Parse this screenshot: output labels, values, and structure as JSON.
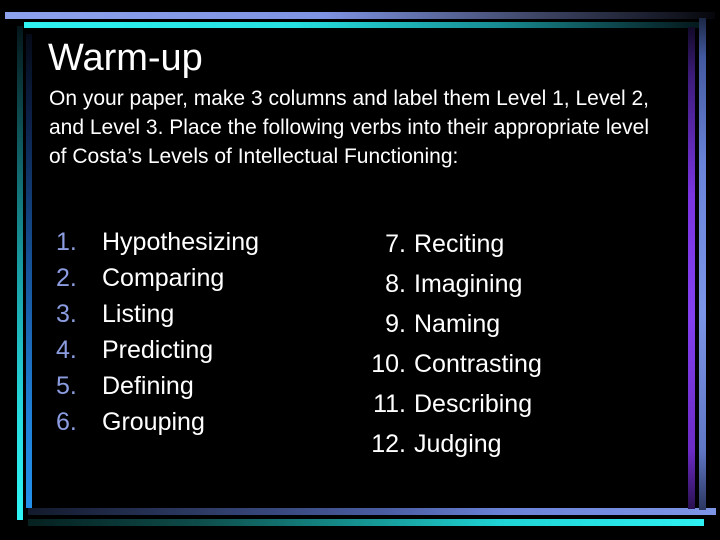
{
  "slide": {
    "title": "Warm-up",
    "intro": "On your paper, make 3 columns and label them Level 1, Level 2, and Level 3. Place the following verbs into their appropriate level of Costa’s Levels of Intellectual Functioning:",
    "background_color": "#000000",
    "text_color": "#ffffff",
    "number_accent_color": "#8b9de0",
    "frame_colors": {
      "cyan": "#2ff2f1",
      "blue": "#7d95e6",
      "purple": "#8240ef"
    },
    "columns": [
      {
        "name": "left-column",
        "items": [
          {
            "num": "1.",
            "text": "Hypothesizing"
          },
          {
            "num": "2.",
            "text": "Comparing"
          },
          {
            "num": "3.",
            "text": "Listing"
          },
          {
            "num": "4.",
            "text": "Predicting"
          },
          {
            "num": "5.",
            "text": "Defining"
          },
          {
            "num": "6.",
            "text": "Grouping"
          }
        ]
      },
      {
        "name": "right-column",
        "items": [
          {
            "num": "7.",
            "text": "Reciting"
          },
          {
            "num": "8.",
            "text": "Imagining"
          },
          {
            "num": "9.",
            "text": "Naming"
          },
          {
            "num": "10.",
            "text": "Contrasting"
          },
          {
            "num": "11.",
            "text": "Describing"
          },
          {
            "num": "12.",
            "text": "Judging"
          }
        ]
      }
    ]
  }
}
